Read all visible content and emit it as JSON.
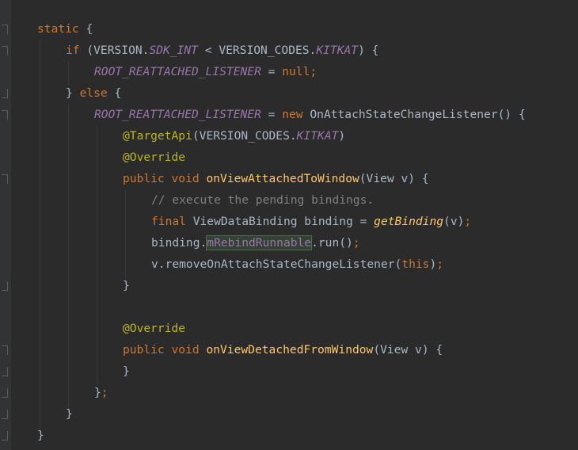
{
  "editor": {
    "lines": [
      {
        "tokens": [
          {
            "t": "static",
            "c": "kw"
          },
          {
            "t": " {",
            "c": "pl"
          }
        ]
      },
      {
        "tokens": [
          {
            "t": "if",
            "c": "kw"
          },
          {
            "t": " (VERSION.",
            "c": "pl"
          },
          {
            "t": "SDK_INT",
            "c": "cn"
          },
          {
            "t": " < VERSION_CODES.",
            "c": "pl"
          },
          {
            "t": "KITKAT",
            "c": "cn"
          },
          {
            "t": ") {",
            "c": "pl"
          }
        ]
      },
      {
        "tokens": [
          {
            "t": "ROOT_REATTACHED_LISTENER",
            "c": "cn"
          },
          {
            "t": " = ",
            "c": "pl"
          },
          {
            "t": "null",
            "c": "kw"
          },
          {
            "t": ";",
            "c": "kw"
          }
        ]
      },
      {
        "tokens": [
          {
            "t": "} ",
            "c": "pl"
          },
          {
            "t": "else",
            "c": "kw"
          },
          {
            "t": " {",
            "c": "pl"
          }
        ]
      },
      {
        "tokens": [
          {
            "t": "ROOT_REATTACHED_LISTENER",
            "c": "cn"
          },
          {
            "t": " = ",
            "c": "pl"
          },
          {
            "t": "new",
            "c": "kw"
          },
          {
            "t": " OnAttachStateChangeListener() {",
            "c": "pl"
          }
        ]
      },
      {
        "tokens": [
          {
            "t": "@TargetApi",
            "c": "an"
          },
          {
            "t": "(VERSION_CODES.",
            "c": "pl"
          },
          {
            "t": "KITKAT",
            "c": "cn"
          },
          {
            "t": ")",
            "c": "pl"
          }
        ]
      },
      {
        "tokens": [
          {
            "t": "@Override",
            "c": "an"
          }
        ]
      },
      {
        "tokens": [
          {
            "t": "public",
            "c": "kw"
          },
          {
            "t": " ",
            "c": "pl"
          },
          {
            "t": "void",
            "c": "kw"
          },
          {
            "t": " ",
            "c": "pl"
          },
          {
            "t": "onViewAttachedToWindow",
            "c": "fn"
          },
          {
            "t": "(View v) {",
            "c": "pl"
          }
        ]
      },
      {
        "tokens": [
          {
            "t": "// execute the pending bindings.",
            "c": "cm"
          }
        ]
      },
      {
        "tokens": [
          {
            "t": "final",
            "c": "kw"
          },
          {
            "t": " ViewDataBinding binding = ",
            "c": "pl"
          },
          {
            "t": "getBinding",
            "c": "it"
          },
          {
            "t": "(v)",
            "c": "pl"
          },
          {
            "t": ";",
            "c": "kw"
          }
        ]
      },
      {
        "tokens": [
          {
            "t": "binding.",
            "c": "pl"
          },
          {
            "t": "mRebindRunnable",
            "c": "fd"
          },
          {
            "t": ".run()",
            "c": "pl"
          },
          {
            "t": ";",
            "c": "kw"
          }
        ]
      },
      {
        "tokens": [
          {
            "t": "v.removeOnAttachStateChangeListener(",
            "c": "pl"
          },
          {
            "t": "this",
            "c": "kw"
          },
          {
            "t": ")",
            "c": "pl"
          },
          {
            "t": ";",
            "c": "kw"
          }
        ]
      },
      {
        "tokens": [
          {
            "t": "}",
            "c": "pl"
          }
        ]
      },
      {
        "tokens": []
      },
      {
        "tokens": [
          {
            "t": "@Override",
            "c": "an"
          }
        ]
      },
      {
        "tokens": [
          {
            "t": "public",
            "c": "kw"
          },
          {
            "t": " ",
            "c": "pl"
          },
          {
            "t": "void",
            "c": "kw"
          },
          {
            "t": " ",
            "c": "pl"
          },
          {
            "t": "onViewDetachedFromWindow",
            "c": "fn"
          },
          {
            "t": "(View v) {",
            "c": "pl"
          }
        ]
      },
      {
        "tokens": [
          {
            "t": "}",
            "c": "pl"
          }
        ]
      },
      {
        "tokens": [
          {
            "t": "}",
            "c": "pl"
          },
          {
            "t": ";",
            "c": "kw"
          }
        ]
      },
      {
        "tokens": [
          {
            "t": "}",
            "c": "pl"
          }
        ]
      },
      {
        "tokens": [
          {
            "t": "}",
            "c": "pl"
          }
        ]
      }
    ]
  },
  "colors": {
    "background": "#2b2b2b",
    "keyword": "#cc7832",
    "constant": "#9876aa",
    "annotation": "#bbb529",
    "method": "#ffc66d",
    "comment": "#808080",
    "text": "#a9b7c6"
  }
}
